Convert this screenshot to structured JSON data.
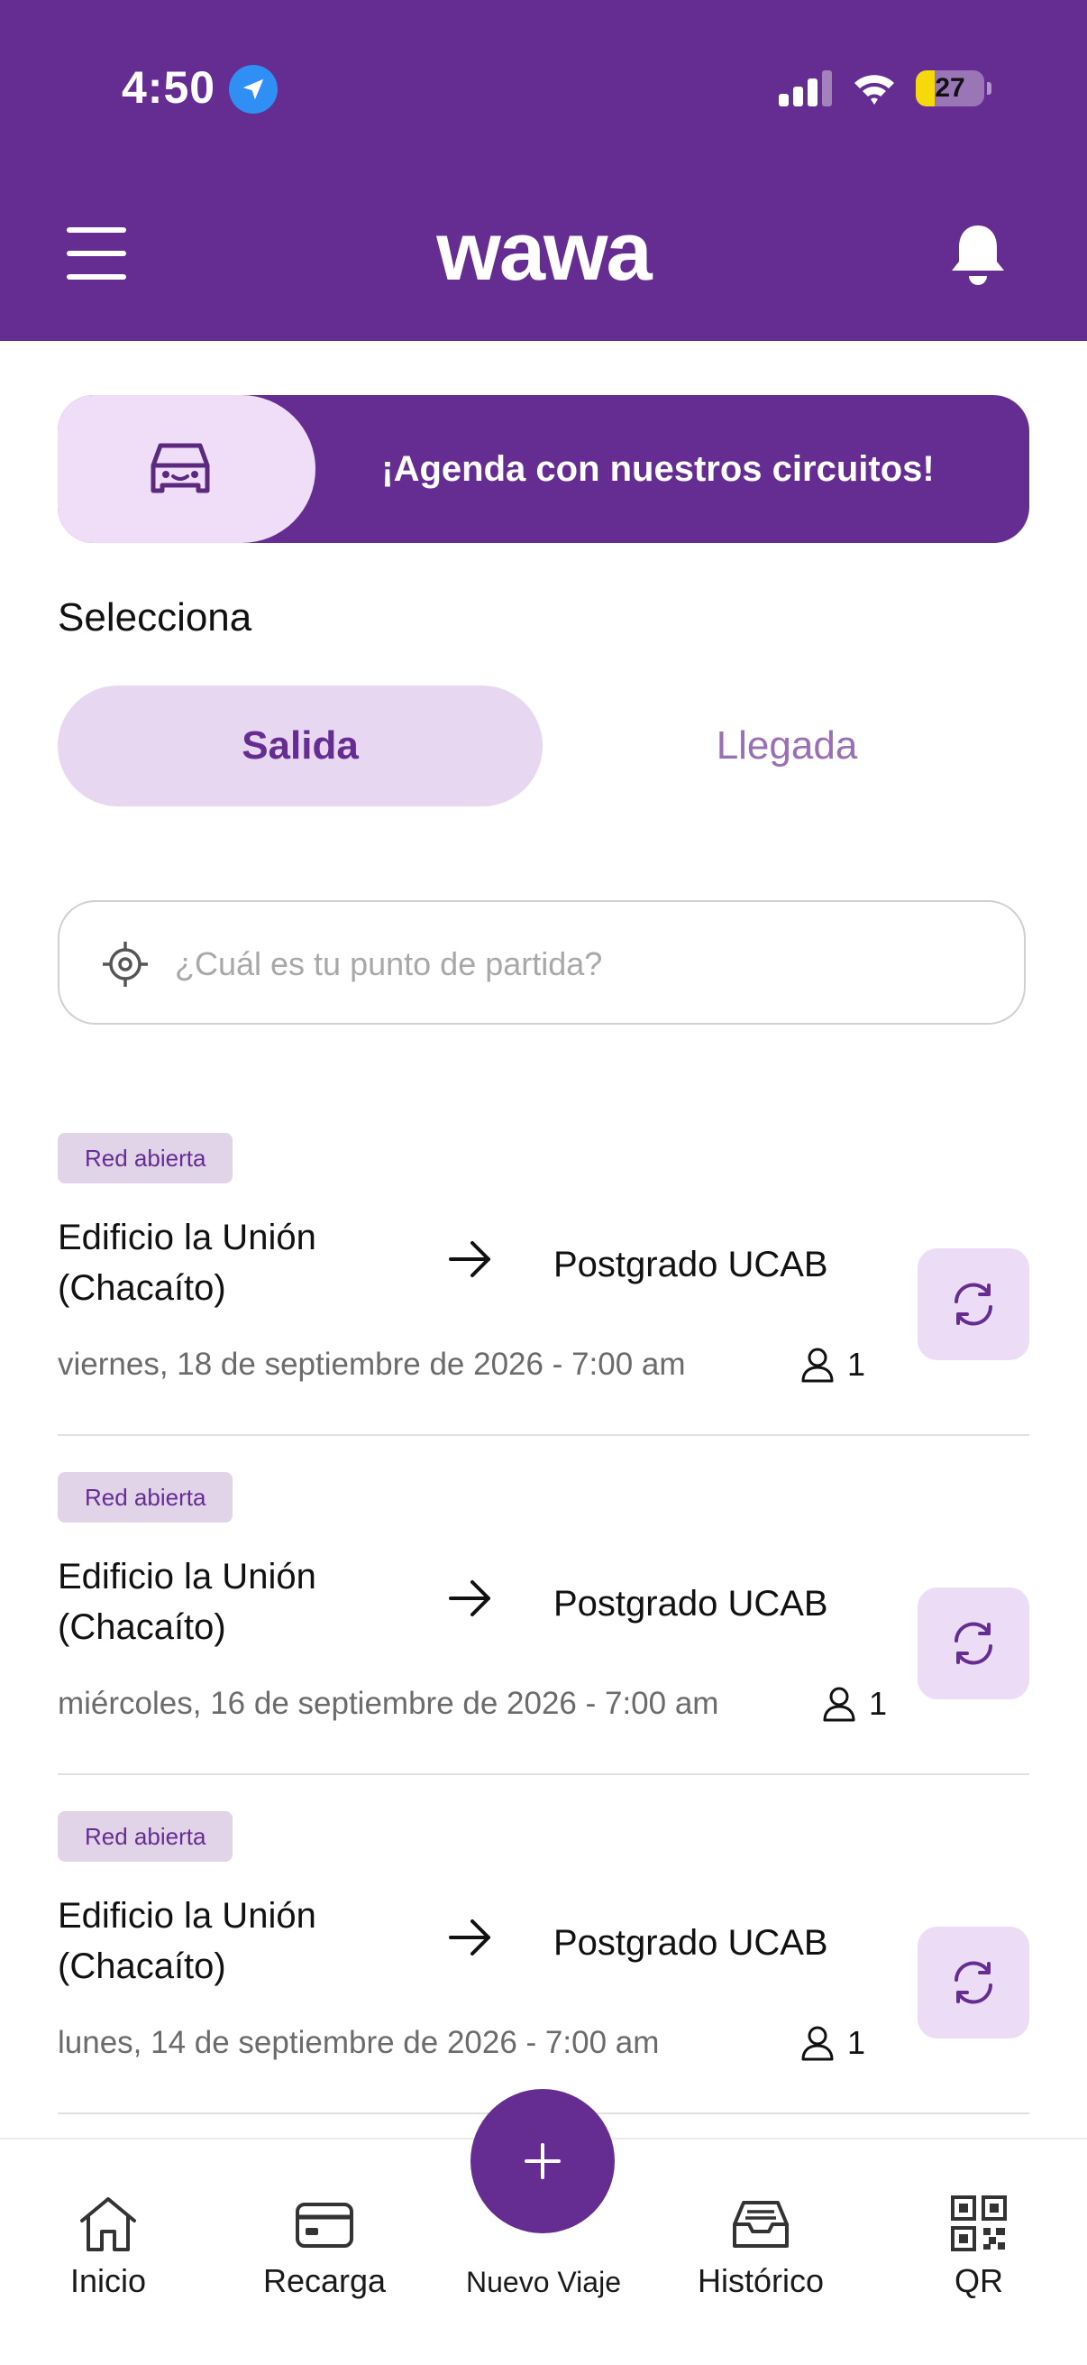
{
  "status_bar": {
    "time": "4:50",
    "battery": "27",
    "battery_level": 0.27
  },
  "header": {
    "logo": "wawa"
  },
  "banner": {
    "text": "¡Agenda con nuestros circuitos!"
  },
  "selector": {
    "title": "Selecciona",
    "options": [
      "Salida",
      "Llegada"
    ],
    "selected": "Salida"
  },
  "search": {
    "placeholder": "¿Cuál es tu punto de partida?"
  },
  "trips": [
    {
      "badge": "Red abierta",
      "origin": "Edificio la Unión (Chacaíto)",
      "destination": "Postgrado UCAB",
      "date": "viernes, 18 de septiembre de 2026 - 7:00 am",
      "passengers": "1"
    },
    {
      "badge": "Red abierta",
      "origin": "Edificio la Unión (Chacaíto)",
      "destination": "Postgrado UCAB",
      "date": "miércoles, 16 de septiembre de 2026 - 7:00 am",
      "passengers": "1"
    },
    {
      "badge": "Red abierta",
      "origin": "Edificio la Unión (Chacaíto)",
      "destination": "Postgrado UCAB",
      "date": "lunes, 14 de septiembre de 2026 - 7:00 am",
      "passengers": "1"
    }
  ],
  "bottom_nav": {
    "items": [
      {
        "label": "Inicio",
        "icon": "home-icon"
      },
      {
        "label": "Recarga",
        "icon": "card-icon"
      },
      {
        "label": "Nuevo Viaje",
        "icon": "plus-icon"
      },
      {
        "label": "Histórico",
        "icon": "inbox-icon"
      },
      {
        "label": "QR",
        "icon": "qr-icon"
      }
    ]
  },
  "colors": {
    "brand": "#652d91",
    "brand_light": "#e8d7f0",
    "badge_bg": "#e2d4e8",
    "refresh_bg": "#ecdcf5"
  }
}
